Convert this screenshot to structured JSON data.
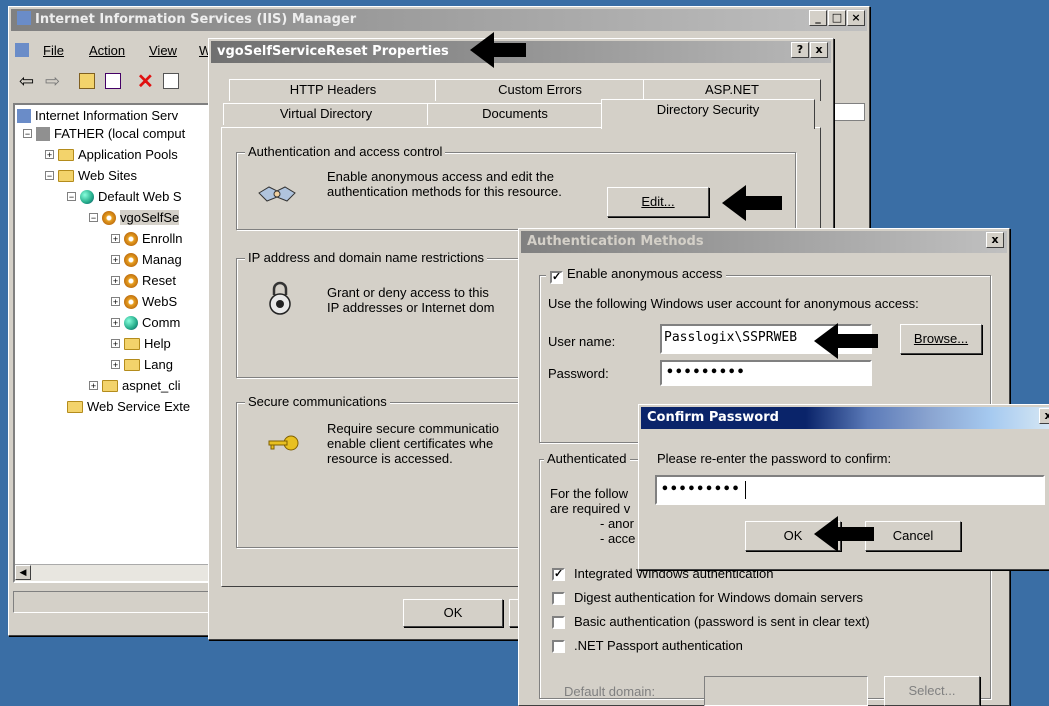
{
  "iis": {
    "title": "Internet Information Services (IIS) Manager",
    "menu": [
      "File",
      "Action",
      "View",
      "W"
    ],
    "tree": {
      "root": "Internet Information Serv",
      "server": "FATHER (local comput",
      "app_pools": "Application Pools",
      "web_sites": "Web Sites",
      "default_site": "Default Web S",
      "vgo": "vgoSelfSe",
      "children": [
        "Enrolln",
        "Manag",
        "Reset",
        "WebS",
        "Comm",
        "Help",
        "Lang"
      ],
      "aspnet": "aspnet_cli",
      "web_service": "Web Service Exte"
    }
  },
  "props": {
    "title": "vgoSelfServiceReset Properties",
    "help_btn": "?",
    "close_btn": "x",
    "tabs_row1": [
      "HTTP Headers",
      "Custom Errors",
      "ASP.NET"
    ],
    "tabs_row2": [
      "Virtual Directory",
      "Documents",
      "Directory Security"
    ],
    "auth_group": "Authentication and access control",
    "auth_text": "Enable anonymous access and edit the authentication methods for this resource.",
    "edit_btn": "Edit...",
    "ip_group": "IP address and domain name restrictions",
    "ip_text1": "Grant or deny access to this",
    "ip_text2": "IP addresses or Internet dom",
    "secure_group": "Secure communications",
    "secure_text1": "Require secure communicatio",
    "secure_text2": "enable client certificates whe",
    "secure_text3": "resource is accessed.",
    "ok_btn": "OK"
  },
  "auth": {
    "title": "Authentication Methods",
    "close_btn": "x",
    "anon_label": "Enable anonymous access",
    "anon_checked": true,
    "use_text": "Use the following Windows user account for anonymous access:",
    "user_label": "User name:",
    "user_value": "Passlogix\\SSPRWEB",
    "browse_btn": "Browse...",
    "password_label": "Password:",
    "password_value": "•••••••••",
    "auth_access_group": "Authenticated",
    "for_follow": "For the follow",
    "are_required": "are required v",
    "bullet1": "- anor",
    "bullet2": "- acce",
    "integrated": "Integrated Windows authentication",
    "digest": "Digest authentication for Windows domain servers",
    "basic": "Basic authentication (password is sent in clear text)",
    "passport": ".NET Passport authentication",
    "default_domain": "Default domain:",
    "select_btn": "Select..."
  },
  "confirm": {
    "title": "Confirm Password",
    "close_btn": "x",
    "prompt": "Please re-enter the password to confirm:",
    "value": "•••••••••",
    "ok_btn": "OK",
    "cancel_btn": "Cancel"
  },
  "colors": {
    "desktop": "#3a6ea5",
    "dialog": "#d4d0c8",
    "title_active": "#0a246a"
  }
}
